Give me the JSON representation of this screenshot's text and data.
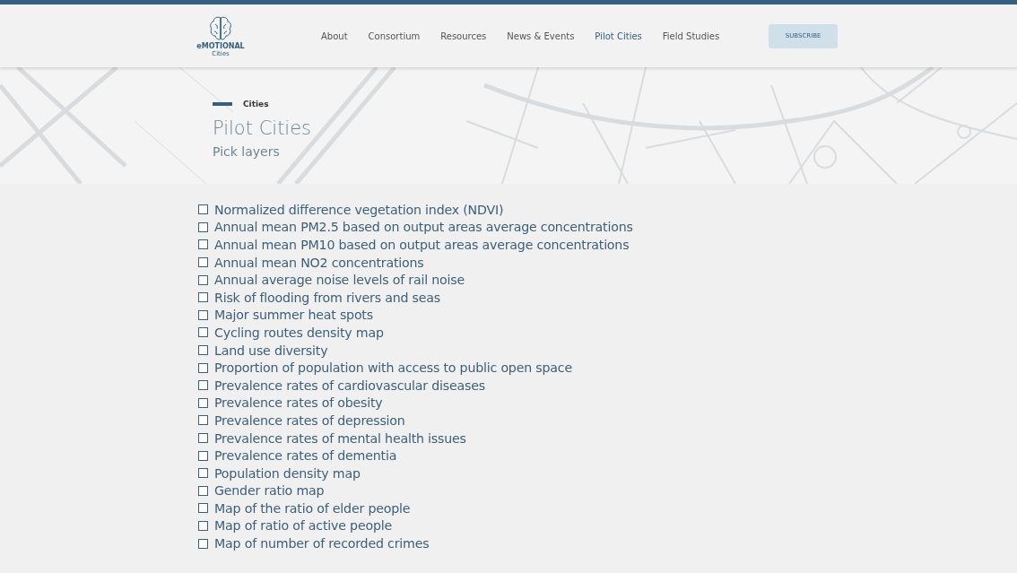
{
  "header": {
    "logo": {
      "name": "eMOTIONAL",
      "sub": "Cities"
    },
    "nav": [
      {
        "label": "About",
        "selected": false
      },
      {
        "label": "Consortium",
        "selected": false
      },
      {
        "label": "Resources",
        "selected": false
      },
      {
        "label": "News & Events",
        "selected": false
      },
      {
        "label": "Pilot Cities",
        "selected": true
      },
      {
        "label": "Field Studies",
        "selected": false
      }
    ],
    "subscribe": "SUBSCRIBE"
  },
  "hero": {
    "kicker": "Cities",
    "title": "Pilot Cities",
    "subtitle": "Pick layers"
  },
  "layers": [
    {
      "label": "Normalized difference vegetation index (NDVI)",
      "checked": false
    },
    {
      "label": "Annual mean PM2.5 based on output areas average concentrations",
      "checked": false
    },
    {
      "label": "Annual mean PM10 based on output areas average concentrations",
      "checked": false
    },
    {
      "label": "Annual mean NO2 concentrations",
      "checked": false
    },
    {
      "label": "Annual average noise levels of rail noise",
      "checked": false
    },
    {
      "label": "Risk of flooding from rivers and seas",
      "checked": false
    },
    {
      "label": "Major summer heat spots",
      "checked": false
    },
    {
      "label": "Cycling routes density map",
      "checked": false
    },
    {
      "label": "Land use diversity",
      "checked": false
    },
    {
      "label": "Proportion of population with access to public open space",
      "checked": false
    },
    {
      "label": "Prevalence rates of cardiovascular diseases",
      "checked": false
    },
    {
      "label": "Prevalence rates of obesity",
      "checked": false
    },
    {
      "label": "Prevalence rates of depression",
      "checked": false
    },
    {
      "label": "Prevalence rates of mental health issues",
      "checked": false
    },
    {
      "label": "Prevalence rates of dementia",
      "checked": false
    },
    {
      "label": "Population density map",
      "checked": false
    },
    {
      "label": "Gender ratio map",
      "checked": false
    },
    {
      "label": "Map of the ratio of elder people",
      "checked": false
    },
    {
      "label": "Map of ratio of active people",
      "checked": false
    },
    {
      "label": "Map of number of recorded crimes",
      "checked": false
    }
  ]
}
